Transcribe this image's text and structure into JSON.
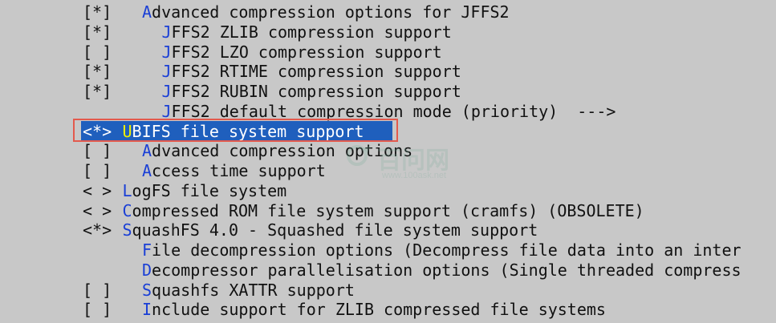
{
  "watermark": {
    "main": "百问网",
    "sub": "www.100ask.net"
  },
  "colors": {
    "background": "#c8c8c8",
    "hotkey": "#1a3fd6",
    "selection": "#1f5fbd",
    "highlight_frame": "#e35a4d"
  },
  "menu": {
    "rows": [
      {
        "mark": "[*]",
        "hotkey": "A",
        "rest": "dvanced compression options for JFFS2",
        "indent": 2
      },
      {
        "mark": "[*]",
        "hotkey": "J",
        "rest": "FFS2 ZLIB compression support",
        "indent": 3
      },
      {
        "mark": "[ ]",
        "hotkey": "J",
        "rest": "FFS2 LZO compression support",
        "indent": 3
      },
      {
        "mark": "[*]",
        "hotkey": "J",
        "rest": "FFS2 RTIME compression support",
        "indent": 3
      },
      {
        "mark": "[*]",
        "hotkey": "J",
        "rest": "FFS2 RUBIN compression support",
        "indent": 3
      },
      {
        "mark": "",
        "hotkey": "J",
        "rest": "FFS2 default compression mode (priority)  --->",
        "indent": 3
      },
      {
        "mark": "<*>",
        "hotkey": "U",
        "rest": "BIFS file system support",
        "indent": 1,
        "selected": true
      },
      {
        "mark": "[ ]",
        "hotkey": "A",
        "rest": "dvanced compression options",
        "indent": 2
      },
      {
        "mark": "[ ]",
        "hotkey": "A",
        "rest": "ccess time support",
        "indent": 2
      },
      {
        "mark": "< >",
        "hotkey": "L",
        "rest": "ogFS file system",
        "indent": 1
      },
      {
        "mark": "< >",
        "hotkey": "C",
        "rest": "ompressed ROM file system support (cramfs) (OBSOLETE)",
        "indent": 1
      },
      {
        "mark": "<*>",
        "hotkey": "S",
        "rest": "quashFS 4.0 - Squashed file system support",
        "indent": 1
      },
      {
        "mark": "",
        "hotkey": "F",
        "rest": "ile decompression options (Decompress file data into an inter",
        "indent": 2
      },
      {
        "mark": "",
        "hotkey": "D",
        "rest": "ecompressor parallelisation options (Single threaded compress",
        "indent": 2
      },
      {
        "mark": "[ ]",
        "hotkey": "S",
        "rest": "quashfs XATTR support",
        "indent": 2
      },
      {
        "mark": "[ ]",
        "hotkey": "I",
        "rest": "nclude support for ZLIB compressed file systems",
        "indent": 2
      }
    ]
  }
}
